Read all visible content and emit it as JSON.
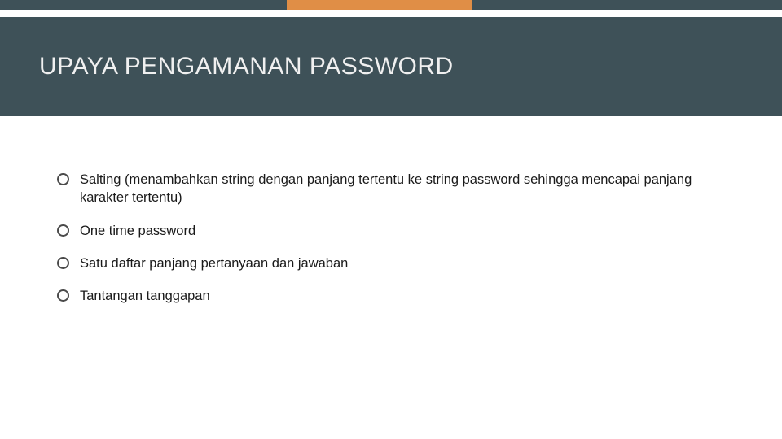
{
  "title": "UPAYA PENGAMANAN PASSWORD",
  "bullets": [
    "Salting (menambahkan string dengan panjang tertentu ke string password sehingga mencapai panjang karakter tertentu)",
    "One time password",
    "Satu daftar panjang pertanyaan dan jawaban",
    "Tantangan tanggapan"
  ],
  "colors": {
    "band": "#3e5158",
    "accent": "#e08e46"
  }
}
